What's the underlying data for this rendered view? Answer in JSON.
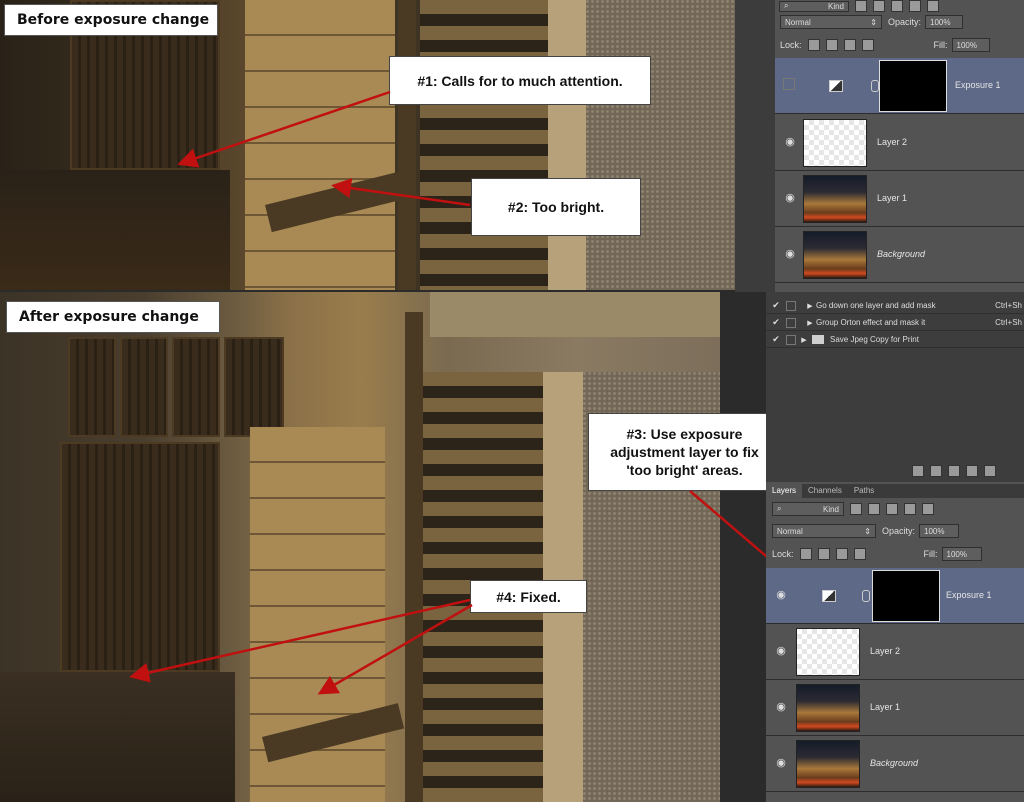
{
  "before": {
    "label": "Before exposure change",
    "callouts": {
      "c1": "#1: Calls for to much attention.",
      "c2": "#2: Too bright."
    }
  },
  "after": {
    "label": "After exposure change",
    "callouts": {
      "c3": [
        "#3: Use exposure",
        "adjustment layer to fix",
        "'too bright' areas."
      ],
      "c4": "#4: Fixed."
    }
  },
  "top_panel": {
    "kind": "Kind",
    "blend_mode": "Normal",
    "opacity_label": "Opacity:",
    "opacity_value": "100%",
    "lock_label": "Lock:",
    "fill_label": "Fill:",
    "fill_value": "100%",
    "layers": [
      {
        "name": "Exposure 1",
        "visible": false,
        "selected": true
      },
      {
        "name": "Layer 2",
        "visible": true
      },
      {
        "name": "Layer 1",
        "visible": true
      },
      {
        "name": "Background",
        "visible": true
      }
    ]
  },
  "actions_panel": {
    "items": [
      {
        "label": "Go down one layer and add mask",
        "shortcut": "Ctrl+Sh"
      },
      {
        "label": "Group Orton effect and mask it",
        "shortcut": "Ctrl+Sh"
      },
      {
        "label": "Save Jpeg Copy for Print",
        "shortcut": ""
      }
    ]
  },
  "bottom_panel": {
    "tabs": [
      "Layers",
      "Channels",
      "Paths"
    ],
    "kind": "Kind",
    "blend_mode": "Normal",
    "opacity_label": "Opacity:",
    "opacity_value": "100%",
    "lock_label": "Lock:",
    "fill_label": "Fill:",
    "fill_value": "100%",
    "layers": [
      {
        "name": "Exposure 1",
        "visible": true,
        "selected": true
      },
      {
        "name": "Layer 2",
        "visible": true
      },
      {
        "name": "Layer 1",
        "visible": true
      },
      {
        "name": "Background",
        "visible": true
      }
    ]
  },
  "colors": {
    "arrow": "#c01010",
    "selected_layer": "#5d6987",
    "panel_bg": "#535353"
  },
  "icons": [
    "eye-icon",
    "search-icon",
    "link-icon",
    "adjustment-icon",
    "folder-icon",
    "checkmark-icon",
    "expand-triangle-icon",
    "lock-icon",
    "move-icon",
    "brush-icon"
  ]
}
